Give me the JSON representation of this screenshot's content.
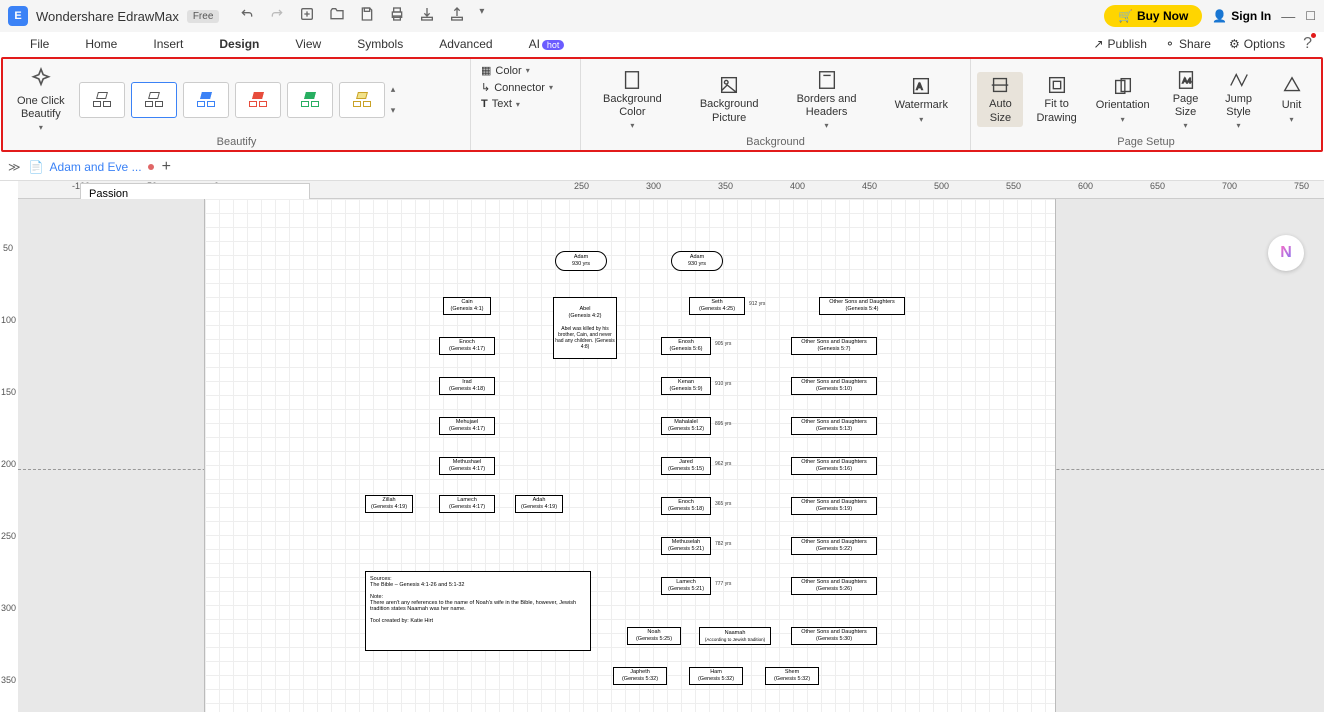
{
  "titlebar": {
    "app_name": "Wondershare EdrawMax",
    "free_badge": "Free",
    "buy_label": "Buy Now",
    "signin_label": "Sign In"
  },
  "menubar": {
    "items": [
      "File",
      "Home",
      "Insert",
      "Design",
      "View",
      "Symbols",
      "Advanced",
      "AI"
    ],
    "active_index": 3,
    "ai_badge": "hot",
    "right": {
      "publish": "Publish",
      "share": "Share",
      "options": "Options"
    }
  },
  "ribbon": {
    "one_click": "One Click\nBeautify",
    "beautify_label": "Beautify",
    "color": "Color",
    "connector": "Connector",
    "text": "Text",
    "bg_color": "Background\nColor",
    "bg_picture": "Background\nPicture",
    "borders": "Borders and\nHeaders",
    "watermark": "Watermark",
    "background_label": "Background",
    "auto_size": "Auto\nSize",
    "fit": "Fit to\nDrawing",
    "orientation": "Orientation",
    "page_size": "Page\nSize",
    "jump_style": "Jump\nStyle",
    "unit": "Unit",
    "page_setup_label": "Page Setup"
  },
  "tabbar": {
    "doc_name": "Adam and Eve ..."
  },
  "search": {
    "value": "Passion"
  },
  "ruler_h": [
    "-100",
    "-50",
    "0",
    "250",
    "300",
    "350",
    "400",
    "450",
    "500",
    "550",
    "600",
    "650",
    "700",
    "750"
  ],
  "ruler_v": [
    "50",
    "100",
    "150",
    "200",
    "250",
    "300",
    "350"
  ],
  "diagram": {
    "adam1": {
      "l1": "Adam",
      "l2": "930 yrs"
    },
    "adam2": {
      "l1": "Adam",
      "l2": "930 yrs"
    },
    "cain": {
      "l1": "Cain",
      "l2": "(Genesis 4:1)"
    },
    "abel": {
      "l1": "Abel",
      "l2": "(Genesis 4:2)",
      "note": "Abel was killed by his brother, Cain, and never had any children. (Genesis 4:8)"
    },
    "seth": {
      "l1": "Seth",
      "l2": "(Genesis 4:25)",
      "age": "912 yrs"
    },
    "osd1": {
      "l1": "Other Sons and Daughters",
      "l2": "(Genesis 5:4)"
    },
    "enoch1": {
      "l1": "Enoch",
      "l2": "(Genesis 4:17)"
    },
    "irad": {
      "l1": "Irad",
      "l2": "(Genesis 4:18)"
    },
    "mehujael": {
      "l1": "Mehujael",
      "l2": "(Genesis 4:17)"
    },
    "methushael": {
      "l1": "Methushael",
      "l2": "(Genesis 4:17)"
    },
    "zillah": {
      "l1": "Zillah",
      "l2": "(Genesis 4:19)"
    },
    "lamech1": {
      "l1": "Lamech",
      "l2": "(Genesis 4:17)"
    },
    "adah": {
      "l1": "Adah",
      "l2": "(Genesis 4:19)"
    },
    "enosh": {
      "l1": "Enosh",
      "l2": "(Genesis 5:6)",
      "age": "905 yrs"
    },
    "osd2": {
      "l1": "Other Sons and Daughters",
      "l2": "(Genesis 5:7)"
    },
    "kenan": {
      "l1": "Kenan",
      "l2": "(Genesis 5:9)",
      "age": "910 yrs"
    },
    "osd3": {
      "l1": "Other Sons and Daughters",
      "l2": "(Genesis 5:10)"
    },
    "mahalalel": {
      "l1": "Mahalalel",
      "l2": "(Genesis 5:12)",
      "age": "895 yrs"
    },
    "osd4": {
      "l1": "Other Sons and Daughters",
      "l2": "(Genesis 5:13)"
    },
    "jared": {
      "l1": "Jared",
      "l2": "(Genesis 5:15)",
      "age": "962 yrs"
    },
    "osd5": {
      "l1": "Other Sons and Daughters",
      "l2": "(Genesis 5:16)"
    },
    "enoch2": {
      "l1": "Enoch",
      "l2": "(Genesis 5:18)",
      "age": "365 yrs"
    },
    "osd6": {
      "l1": "Other Sons and Daughters",
      "l2": "(Genesis 5:19)"
    },
    "methuselah": {
      "l1": "Methuselah",
      "l2": "(Genesis 5:21)",
      "age": "782 yrs"
    },
    "osd7": {
      "l1": "Other Sons and Daughters",
      "l2": "(Genesis 5:22)"
    },
    "lamech2": {
      "l1": "Lamech",
      "l2": "(Genesis 5:21)",
      "age": "777 yrs"
    },
    "osd8": {
      "l1": "Other Sons and Daughters",
      "l2": "(Genesis 5:26)"
    },
    "noah": {
      "l1": "Noah",
      "l2": "(Genesis 5:25)"
    },
    "naamah": {
      "l1": "Naamah",
      "l2": "(According to Jewish tradition)"
    },
    "osd9": {
      "l1": "Other Sons and Daughters",
      "l2": "(Genesis 5:30)"
    },
    "japheth": {
      "l1": "Japheth",
      "l2": "(Genesis 5:32)"
    },
    "ham": {
      "l1": "Ham",
      "l2": "(Genesis 5:32)"
    },
    "shem": {
      "l1": "Shem",
      "l2": "(Genesis 5:32)"
    },
    "notes": "Sources:\nThe Bible – Genesis 4:1-26 and 5:1-32\n\nNote:\nThere aren't any references to the name of Noah's wife in the Bible, however, Jewish tradition states Naamah was her name.\n\nTool created by: Katie Hirt"
  }
}
